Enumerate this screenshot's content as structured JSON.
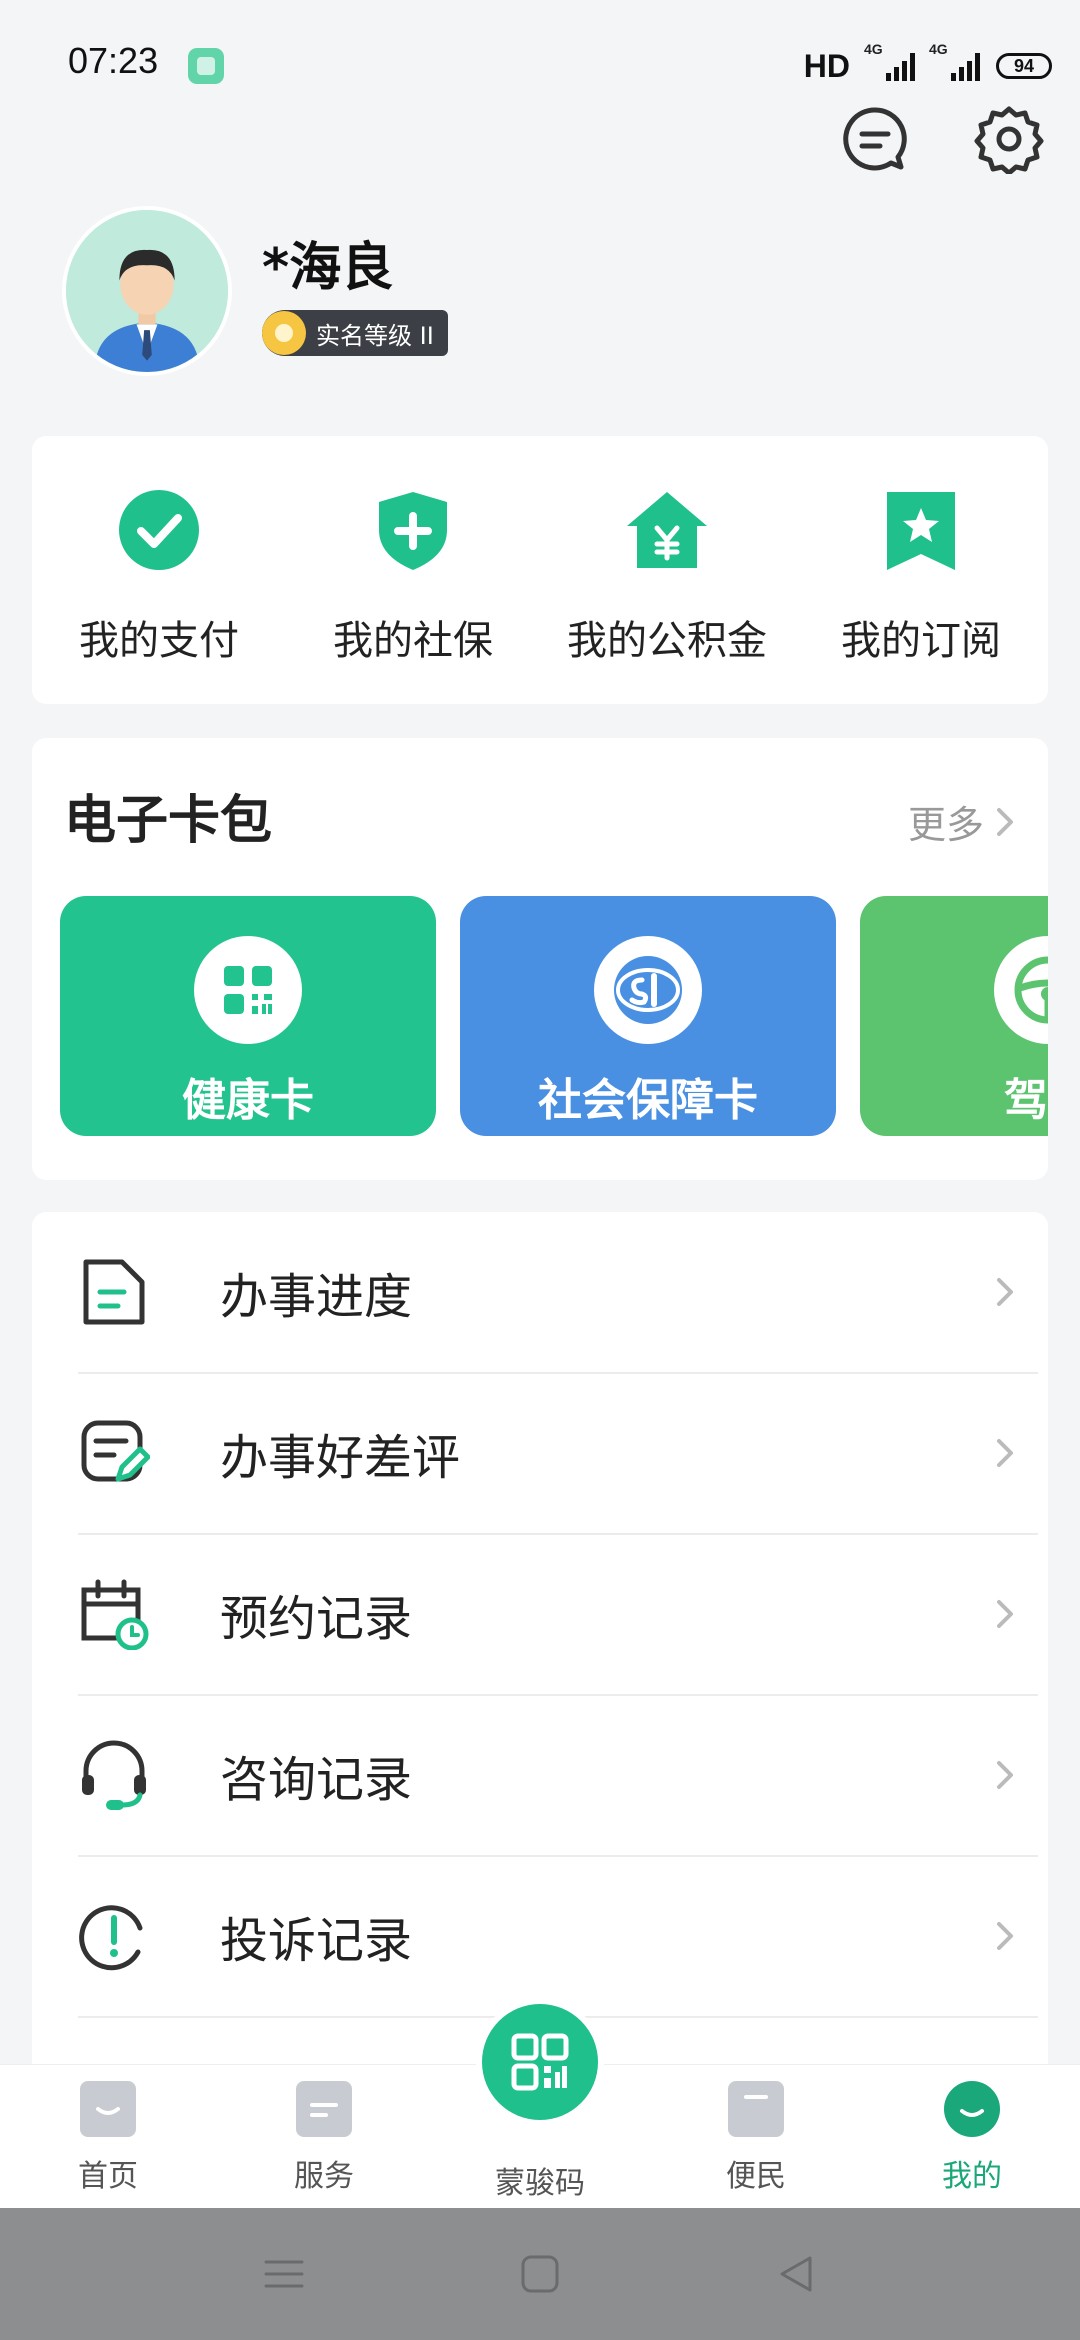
{
  "status_bar": {
    "time": "07:23",
    "hd": "HD",
    "signal1": "4G",
    "signal2": "4G",
    "battery": "94"
  },
  "profile": {
    "name": "*海良",
    "verify_level": "实名等级 II"
  },
  "quick_actions": [
    {
      "label": "我的支付",
      "icon": "check-circle-icon"
    },
    {
      "label": "我的社保",
      "icon": "shield-plus-icon"
    },
    {
      "label": "我的公积金",
      "icon": "house-yen-icon"
    },
    {
      "label": "我的订阅",
      "icon": "bookmark-star-icon"
    }
  ],
  "wallet": {
    "title": "电子卡包",
    "more": "更多",
    "cards": [
      {
        "label": "健康卡",
        "color": "#22c38e",
        "icon": "qr-code-icon"
      },
      {
        "label": "社会保障卡",
        "color": "#4a90e2",
        "icon": "social-security-icon"
      },
      {
        "label": "驾驶",
        "color": "#5cc36f",
        "icon": "steering-wheel-icon"
      }
    ]
  },
  "menu": [
    {
      "label": "办事进度",
      "icon": "document-progress-icon"
    },
    {
      "label": "办事好差评",
      "icon": "review-edit-icon"
    },
    {
      "label": "预约记录",
      "icon": "calendar-clock-icon"
    },
    {
      "label": "咨询记录",
      "icon": "headset-icon"
    },
    {
      "label": "投诉记录",
      "icon": "alert-circle-icon"
    }
  ],
  "tabbar": {
    "home": "首页",
    "services": "服务",
    "center": "蒙骏码",
    "convenience": "便民",
    "mine": "我的"
  },
  "colors": {
    "accent": "#1fc08c",
    "active_tab": "#1aa77a"
  }
}
